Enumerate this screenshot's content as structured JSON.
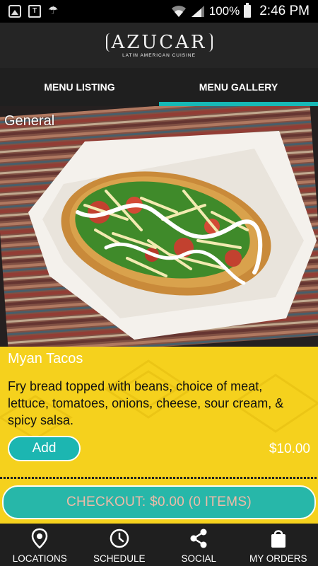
{
  "status_bar": {
    "battery": "100%",
    "time": "2:46 PM",
    "left_icons": [
      "image-notification-icon",
      "tmobile-icon",
      "weather-icon"
    ],
    "right_icons": [
      "wifi-icon",
      "signal-icon",
      "battery-icon"
    ]
  },
  "header": {
    "logo_text": "AZUCAR",
    "logo_tagline": "LATIN AMERICAN CUISINE"
  },
  "tabs": [
    {
      "label": "MENU LISTING",
      "active": false
    },
    {
      "label": "MENU GALLERY",
      "active": true
    }
  ],
  "gallery": {
    "category": "General",
    "item": {
      "name": "Myan Tacos",
      "description": "Fry bread topped with beans, choice of meat, lettuce, tomatoes, onions, cheese, sour cream, & spicy salsa.",
      "add_label": "Add",
      "price": "$10.00"
    }
  },
  "checkout": {
    "label": "CHECKOUT: $0.00 (0 ITEMS)"
  },
  "bottom_nav": [
    {
      "label": "LOCATIONS",
      "icon": "location-pin-icon"
    },
    {
      "label": "SCHEDULE",
      "icon": "clock-icon"
    },
    {
      "label": "SOCIAL",
      "icon": "share-icon"
    },
    {
      "label": "MY ORDERS",
      "icon": "shopping-bag-icon"
    }
  ],
  "colors": {
    "accent": "#17b8b6",
    "panel": "#f5d11d",
    "bar": "#1f1f1f"
  }
}
